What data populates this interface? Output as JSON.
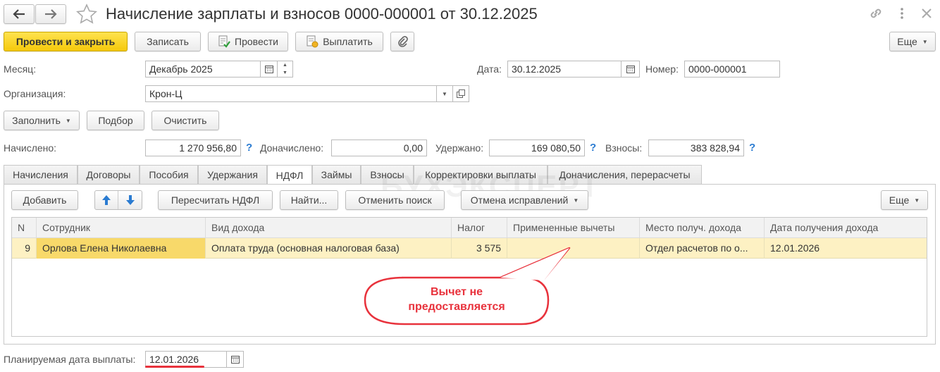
{
  "window": {
    "title": "Начисление зарплаты и взносов 0000-000001 от 30.12.2025"
  },
  "toolbar": {
    "post_close": "Провести и закрыть",
    "save": "Записать",
    "post": "Провести",
    "pay": "Выплатить",
    "more": "Еще"
  },
  "header": {
    "month_label": "Месяц:",
    "month_value": "Декабрь 2025",
    "date_label": "Дата:",
    "date_value": "30.12.2025",
    "number_label": "Номер:",
    "number_value": "0000-000001",
    "org_label": "Организация:",
    "org_value": "Крон-Ц"
  },
  "actions": {
    "fill": "Заполнить",
    "select": "Подбор",
    "clear": "Очистить"
  },
  "totals": {
    "accrued_label": "Начислено:",
    "accrued_value": "1 270 956,80",
    "extra_label": "Доначислено:",
    "extra_value": "0,00",
    "withheld_label": "Удержано:",
    "withheld_value": "169 080,50",
    "contrib_label": "Взносы:",
    "contrib_value": "383 828,94"
  },
  "tabs": [
    "Начисления",
    "Договоры",
    "Пособия",
    "Удержания",
    "НДФЛ",
    "Займы",
    "Взносы",
    "Корректировки выплаты",
    "Доначисления, перерасчеты"
  ],
  "active_tab": "НДФЛ",
  "tab_toolbar": {
    "add": "Добавить",
    "recalc": "Пересчитать НДФЛ",
    "find": "Найти...",
    "cancel_search": "Отменить поиск",
    "cancel_fix": "Отмена исправлений",
    "more": "Еще"
  },
  "table": {
    "columns": [
      "N",
      "Сотрудник",
      "Вид дохода",
      "Налог",
      "Примененные вычеты",
      "Место получ. дохода",
      "Дата получения дохода"
    ],
    "rows": [
      {
        "n": "9",
        "employee": "Орлова Елена Николаевна",
        "income_type": "Оплата труда (основная налоговая база)",
        "tax": "3 575",
        "deductions": "",
        "place": "Отдел расчетов по о...",
        "date": "12.01.2026"
      }
    ]
  },
  "callout": {
    "text_line1": "Вычет не",
    "text_line2": "предоставляется"
  },
  "footer": {
    "planned_label": "Планируемая дата выплаты:",
    "planned_value": "12.01.2026"
  },
  "watermark": "БУХЭКСПЕРТ",
  "colors": {
    "accent_yellow": "#f5c90a",
    "selected_row": "#fdf1c3",
    "callout_red": "#e8323c",
    "help_blue": "#2a7bd1",
    "arrow_blue": "#2a7bd1"
  },
  "icons": [
    "back-arrow-icon",
    "forward-arrow-icon",
    "star-icon",
    "link-icon",
    "more-vert-icon",
    "close-icon",
    "post-icon",
    "pay-icon",
    "paperclip-icon",
    "calendar-icon",
    "up-arrow-icon",
    "down-arrow-icon"
  ]
}
